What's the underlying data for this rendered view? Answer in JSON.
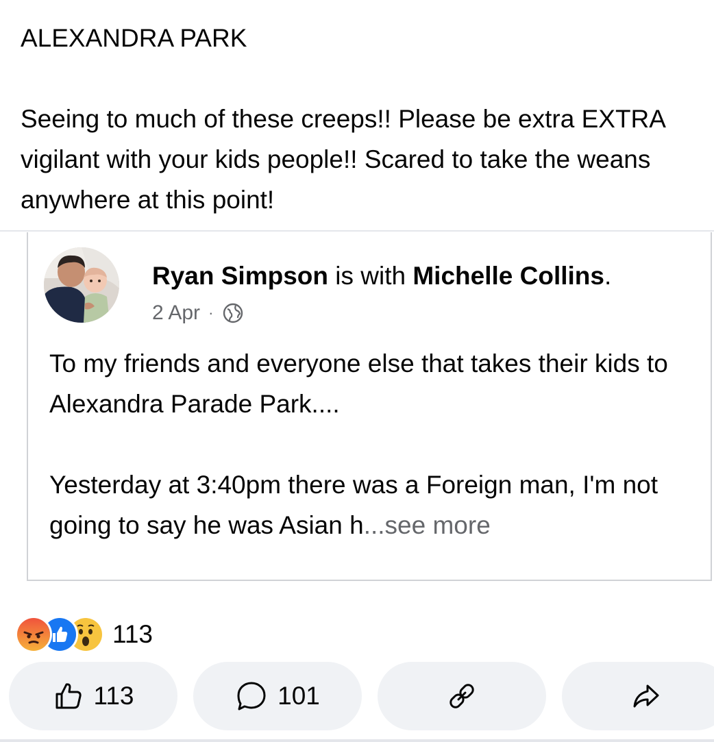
{
  "post": {
    "heading": "ALEXANDRA PARK",
    "body": "Seeing to much of these creeps!! Please be extra EXTRA vigilant with your kids people!! Scared to take the weans anywhere at this point!"
  },
  "shared_post": {
    "author": "Ryan Simpson",
    "with_text": " is with ",
    "tagged": "Michelle Collins",
    "period": ".",
    "date": "2 Apr",
    "separator": "·",
    "privacy_icon": "globe-icon",
    "paragraph1": "To my friends and everyone else that takes their kids to Alexandra Parade Park....",
    "paragraph2": "Yesterday at 3:40pm there was a Foreign man, I'm not going to say he was Asian h",
    "see_more": "...see more"
  },
  "reactions": {
    "icons": [
      "angry-icon",
      "like-icon",
      "wow-icon"
    ],
    "count": "113"
  },
  "actions": {
    "like_count": "113",
    "comment_count": "101",
    "link_icon": "link-icon",
    "share_icon": "share-icon"
  },
  "colors": {
    "text": "#050505",
    "secondary": "#65676b",
    "button_bg": "#f0f2f5",
    "like_blue": "#1877f2",
    "angry_red": "#e9573f",
    "wow_yellow": "#f7b125"
  }
}
